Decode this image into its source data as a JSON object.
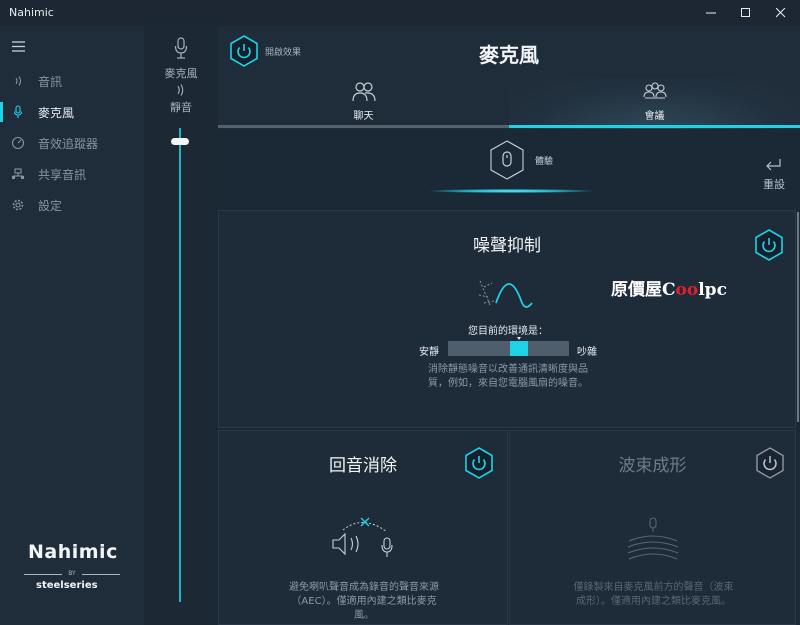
{
  "window": {
    "title": "Nahimic"
  },
  "sidebar": {
    "items": [
      {
        "label": "音訊",
        "icon": "sound-icon",
        "active": false
      },
      {
        "label": "麥克風",
        "icon": "microphone-icon",
        "active": true
      },
      {
        "label": "音效追蹤器",
        "icon": "sound-tracker-icon",
        "active": false
      },
      {
        "label": "共享音訊",
        "icon": "share-audio-icon",
        "active": false
      },
      {
        "label": "設定",
        "icon": "gear-icon",
        "active": false
      }
    ],
    "logo": {
      "brand": "Nahimic",
      "by": "BY",
      "maker": "steelseries"
    }
  },
  "volume": {
    "mic_label": "麥克風",
    "mute_label": "靜音"
  },
  "header": {
    "enable_label": "開啟效果",
    "title": "麥克風",
    "tabs": [
      {
        "label": "聊天",
        "icon": "chat-icon",
        "active": false
      },
      {
        "label": "會議",
        "icon": "meeting-icon",
        "active": true
      }
    ]
  },
  "experience": {
    "label": "體驗",
    "reset_label": "重設"
  },
  "noise_suppression": {
    "title": "噪聲抑制",
    "env_label": "您目前的環境是：",
    "left": "安靜",
    "right": "吵雜",
    "level": 0.6,
    "description_1": "消除靜態噪音以改善通訊清晰度與品",
    "description_2": "質，例如，來自您電腦風扇的噪音。",
    "watermark_prefix": "原價屋",
    "watermark_c": "C",
    "watermark_oo": "oo",
    "watermark_suffix": "lpc"
  },
  "echo_cancellation": {
    "title": "回音消除",
    "description_1": "避免喇叭聲音成為錄音的聲音來源",
    "description_2": "（AEC）。僅適用內建之類比麥克",
    "description_3": "風。"
  },
  "beamforming": {
    "title": "波束成形",
    "description_1": "僅錄製來自麥克風前方的聲音（波束",
    "description_2": "成形）。僅適用內建之類比麥克風。"
  },
  "colors": {
    "accent": "#1fd2e6",
    "background": "#1b2836",
    "sidebar": "#1f2c39"
  }
}
